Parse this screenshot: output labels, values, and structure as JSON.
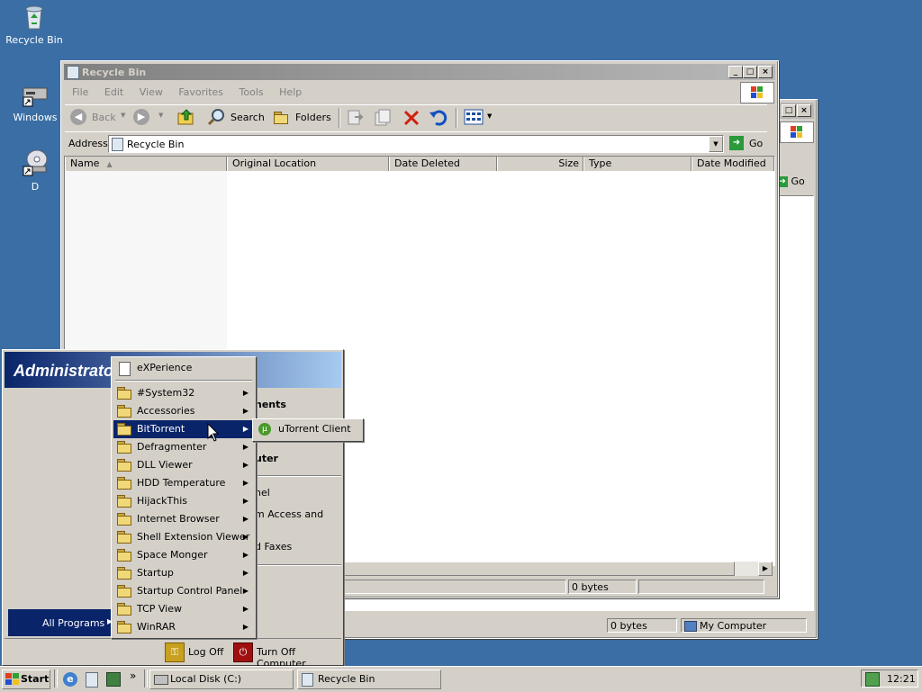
{
  "desktop": {
    "icons": [
      {
        "label": "Recycle Bin"
      },
      {
        "label": "Windows"
      },
      {
        "label": "D"
      }
    ]
  },
  "back_window": {
    "go_label": "Go",
    "status_size": "0 bytes",
    "status_location": "My Computer"
  },
  "window": {
    "title": "Recycle Bin",
    "menu": [
      "File",
      "Edit",
      "View",
      "Favorites",
      "Tools",
      "Help"
    ],
    "toolbar": {
      "back": "Back",
      "search": "Search",
      "folders": "Folders"
    },
    "address_label": "Address",
    "address_value": "Recycle Bin",
    "go_label": "Go",
    "columns": [
      "Name",
      "Original Location",
      "Date Deleted",
      "Size",
      "Type",
      "Date Modified"
    ],
    "status_size": "0 bytes"
  },
  "start_menu": {
    "user": "Administrato",
    "right_fragments": [
      "nents",
      "uter",
      "nel",
      "m Access and",
      "d Faxes"
    ],
    "all_programs": "All Programs",
    "log_off": "Log Off",
    "turn_off": "Turn Off Computer"
  },
  "programs_menu": {
    "items": [
      {
        "label": "eXPerience",
        "submenu": false,
        "icon": "document-icon"
      },
      {
        "label": "#System32",
        "submenu": true
      },
      {
        "label": "Accessories",
        "submenu": true
      },
      {
        "label": "BitTorrent",
        "submenu": true,
        "selected": true
      },
      {
        "label": "Defragmenter",
        "submenu": true
      },
      {
        "label": "DLL Viewer",
        "submenu": true
      },
      {
        "label": "HDD Temperature",
        "submenu": true
      },
      {
        "label": "HijackThis",
        "submenu": true
      },
      {
        "label": "Internet Browser",
        "submenu": true
      },
      {
        "label": "Shell Extension Viewer",
        "submenu": true
      },
      {
        "label": "Space Monger",
        "submenu": true
      },
      {
        "label": "Startup",
        "submenu": true
      },
      {
        "label": "Startup Control Panel",
        "submenu": true
      },
      {
        "label": "TCP View",
        "submenu": true
      },
      {
        "label": "WinRAR",
        "submenu": true
      }
    ]
  },
  "bittorrent_submenu": {
    "items": [
      {
        "label": "uTorrent Client"
      }
    ]
  },
  "taskbar": {
    "start_label": "Start",
    "overflow": "»",
    "tasks": [
      {
        "label": "Local Disk (C:)"
      },
      {
        "label": "Recycle Bin"
      }
    ],
    "clock": "12:21"
  },
  "colors": {
    "desktop": "#3a6ea5",
    "selection": "#0a246a",
    "face": "#d4d0c8",
    "start_header": "#0a246a"
  }
}
